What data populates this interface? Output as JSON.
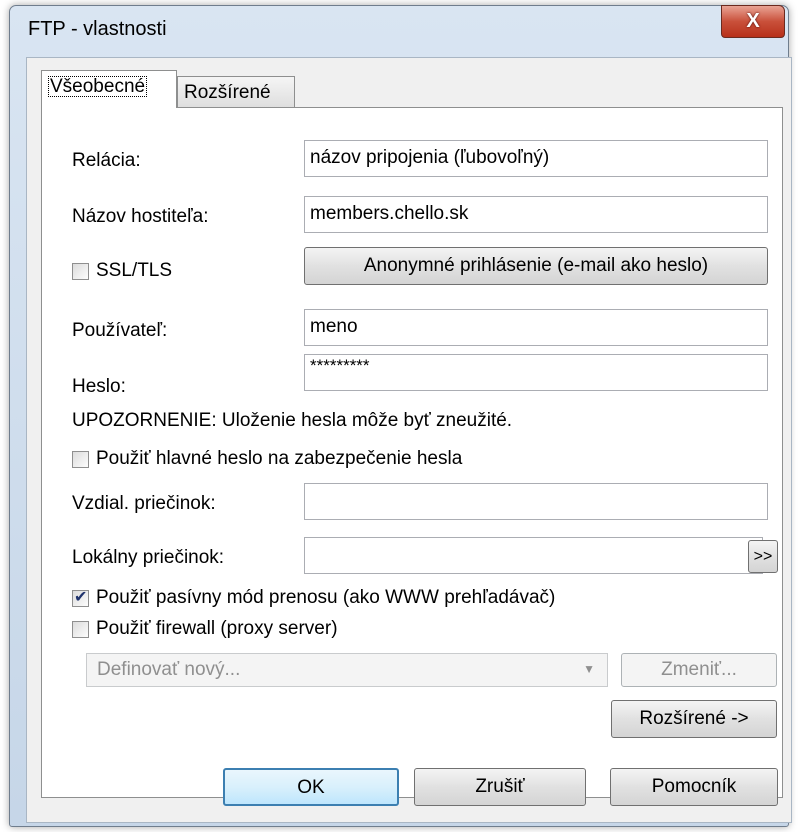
{
  "window": {
    "title": "FTP - vlastnosti",
    "close_glyph": "X"
  },
  "tabs": [
    {
      "label": "Všeobecné"
    },
    {
      "label": "Rozšírené"
    }
  ],
  "fields": {
    "session": {
      "label": "Relácia:",
      "value": "názov pripojenia (ľubovoľný)"
    },
    "host": {
      "label": "Názov hostiteľa:",
      "value": "members.chello.sk"
    },
    "ssl": {
      "label": "SSL/TLS",
      "checked": false
    },
    "anonymous_button": "Anonymné prihlásenie (e-mail ako heslo)",
    "user": {
      "label": "Používateľ:",
      "value": "meno"
    },
    "password": {
      "label": "Heslo:",
      "value": "*********"
    },
    "warning": "UPOZORNENIE: Uloženie hesla môže byť zneužité.",
    "master_password": {
      "label": "Použiť hlavné heslo na zabezpečenie hesla",
      "checked": false
    },
    "remote_folder": {
      "label": "Vzdial. priečinok:",
      "value": ""
    },
    "local_folder": {
      "label": "Lokálny priečinok:",
      "value": ""
    },
    "browse_button": ">>",
    "passive_mode": {
      "label": "Použiť pasívny mód prenosu (ako WWW prehľadávač)",
      "checked": true
    },
    "firewall": {
      "label": "Použiť firewall (proxy server)",
      "checked": false
    },
    "proxy_select": {
      "value": "Definovať nový..."
    },
    "change_button": "Zmeniť...",
    "advanced_button": "Rozšírené ->"
  },
  "footer": {
    "ok": "OK",
    "cancel": "Zrušiť",
    "help": "Pomocník"
  }
}
